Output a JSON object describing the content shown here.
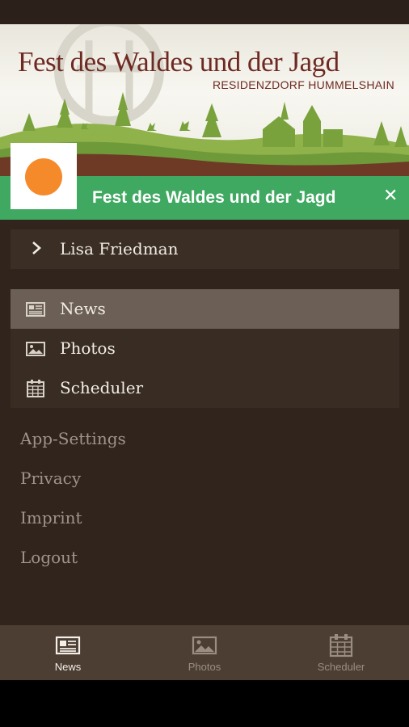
{
  "banner": {
    "title": "Fest des Waldes und der Jagd",
    "subtitle": "RESIDENZDORF HUMMELSHAIN"
  },
  "header": {
    "title": "Fest des Waldes und der Jagd",
    "close_glyph": "✕",
    "logo_icon": "orange-circle-logo"
  },
  "user": {
    "name": "Lisa Friedman",
    "icon": "chevron-right-icon"
  },
  "menu": {
    "items": [
      {
        "label": "News",
        "icon": "newspaper-icon",
        "active": true
      },
      {
        "label": "Photos",
        "icon": "image-icon",
        "active": false
      },
      {
        "label": "Scheduler",
        "icon": "calendar-icon",
        "active": false
      }
    ]
  },
  "links": [
    "App-Settings",
    "Privacy",
    "Imprint",
    "Logout"
  ],
  "tabs": [
    {
      "label": "News",
      "icon": "newspaper-icon",
      "active": true
    },
    {
      "label": "Photos",
      "icon": "image-icon",
      "active": false
    },
    {
      "label": "Scheduler",
      "icon": "calendar-icon",
      "active": false
    }
  ],
  "colors": {
    "accent_green": "#3fa861",
    "logo_orange": "#f58a2b",
    "drawer_bg": "#30241c",
    "active_item": "#6c5f55",
    "banner_text": "#6e2a22"
  }
}
